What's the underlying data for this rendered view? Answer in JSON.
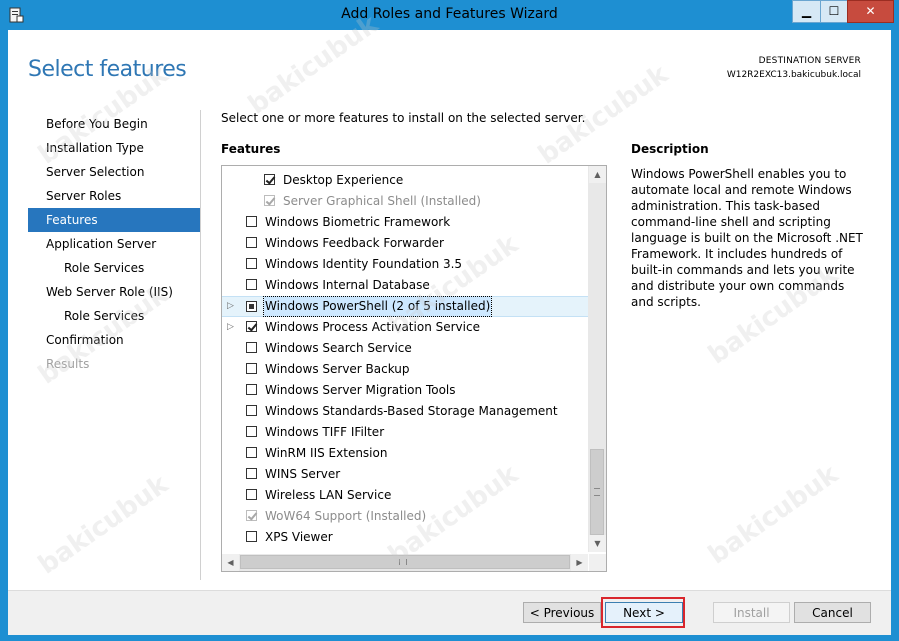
{
  "window": {
    "title": "Add Roles and Features Wizard",
    "min_glyph": "▁",
    "max_glyph": "☐",
    "close_glyph": "✕"
  },
  "header": {
    "page_title": "Select features",
    "destination_label": "DESTINATION SERVER",
    "destination_server": "W12R2EXC13.bakicubuk.local"
  },
  "nav": {
    "items": [
      {
        "label": "Before You Begin",
        "state": "normal",
        "level": 0
      },
      {
        "label": "Installation Type",
        "state": "normal",
        "level": 0
      },
      {
        "label": "Server Selection",
        "state": "normal",
        "level": 0
      },
      {
        "label": "Server Roles",
        "state": "normal",
        "level": 0
      },
      {
        "label": "Features",
        "state": "active",
        "level": 0
      },
      {
        "label": "Application Server",
        "state": "normal",
        "level": 0
      },
      {
        "label": "Role Services",
        "state": "normal",
        "level": 1
      },
      {
        "label": "Web Server Role (IIS)",
        "state": "normal",
        "level": 0
      },
      {
        "label": "Role Services",
        "state": "normal",
        "level": 1
      },
      {
        "label": "Confirmation",
        "state": "normal",
        "level": 0
      },
      {
        "label": "Results",
        "state": "disabled",
        "level": 0
      }
    ]
  },
  "main": {
    "intro": "Select one or more features to install on the selected server.",
    "features_heading": "Features",
    "features": [
      {
        "label": "Desktop Experience",
        "checked": true,
        "disabled": false,
        "indent": 1,
        "expandable": false,
        "selected": false
      },
      {
        "label": "Server Graphical Shell (Installed)",
        "checked": true,
        "disabled": true,
        "indent": 1,
        "expandable": false,
        "selected": false
      },
      {
        "label": "Windows Biometric Framework",
        "checked": false,
        "disabled": false,
        "indent": 0,
        "expandable": false,
        "selected": false
      },
      {
        "label": "Windows Feedback Forwarder",
        "checked": false,
        "disabled": false,
        "indent": 0,
        "expandable": false,
        "selected": false
      },
      {
        "label": "Windows Identity Foundation 3.5",
        "checked": false,
        "disabled": false,
        "indent": 0,
        "expandable": false,
        "selected": false
      },
      {
        "label": "Windows Internal Database",
        "checked": false,
        "disabled": false,
        "indent": 0,
        "expandable": false,
        "selected": false
      },
      {
        "label": "Windows PowerShell (2 of 5 installed)",
        "checked": "partial",
        "disabled": false,
        "indent": 0,
        "expandable": true,
        "selected": true
      },
      {
        "label": "Windows Process Activation Service",
        "checked": true,
        "disabled": false,
        "indent": 0,
        "expandable": true,
        "selected": false
      },
      {
        "label": "Windows Search Service",
        "checked": false,
        "disabled": false,
        "indent": 0,
        "expandable": false,
        "selected": false
      },
      {
        "label": "Windows Server Backup",
        "checked": false,
        "disabled": false,
        "indent": 0,
        "expandable": false,
        "selected": false
      },
      {
        "label": "Windows Server Migration Tools",
        "checked": false,
        "disabled": false,
        "indent": 0,
        "expandable": false,
        "selected": false
      },
      {
        "label": "Windows Standards-Based Storage Management",
        "checked": false,
        "disabled": false,
        "indent": 0,
        "expandable": false,
        "selected": false
      },
      {
        "label": "Windows TIFF IFilter",
        "checked": false,
        "disabled": false,
        "indent": 0,
        "expandable": false,
        "selected": false
      },
      {
        "label": "WinRM IIS Extension",
        "checked": false,
        "disabled": false,
        "indent": 0,
        "expandable": false,
        "selected": false
      },
      {
        "label": "WINS Server",
        "checked": false,
        "disabled": false,
        "indent": 0,
        "expandable": false,
        "selected": false
      },
      {
        "label": "Wireless LAN Service",
        "checked": false,
        "disabled": false,
        "indent": 0,
        "expandable": false,
        "selected": false
      },
      {
        "label": "WoW64 Support (Installed)",
        "checked": true,
        "disabled": true,
        "indent": 0,
        "expandable": false,
        "selected": false
      },
      {
        "label": "XPS Viewer",
        "checked": false,
        "disabled": false,
        "indent": 0,
        "expandable": false,
        "selected": false
      }
    ],
    "description_heading": "Description",
    "description_text": "Windows PowerShell enables you to automate local and remote Windows administration. This task-based command-line shell and scripting language is built on the Microsoft .NET Framework. It includes hundreds of built-in commands and lets you write and distribute your own commands and scripts."
  },
  "footer": {
    "previous_label": "< Previous",
    "next_label": "Next >",
    "install_label": "Install",
    "cancel_label": "Cancel"
  },
  "watermark_text": "bakicubuk",
  "colors": {
    "accent": "#2776be",
    "title_blue": "#2f77b4",
    "highlight_red": "#d9262c"
  }
}
